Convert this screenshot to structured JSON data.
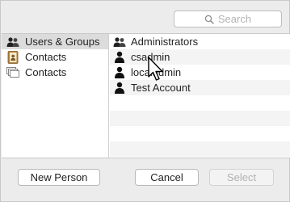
{
  "search": {
    "placeholder": "Search",
    "icon": "magnifier-icon"
  },
  "sources": [
    {
      "label": "Users & Groups",
      "icon": "group-icon",
      "selected": true
    },
    {
      "label": "Contacts",
      "icon": "address-book-icon",
      "selected": false
    },
    {
      "label": "Contacts",
      "icon": "cards-stack-icon",
      "selected": false
    }
  ],
  "members": [
    {
      "label": "Administrators",
      "icon": "group-icon"
    },
    {
      "label": "csadmin",
      "icon": "user-icon"
    },
    {
      "label": "localadmin",
      "icon": "user-icon"
    },
    {
      "label": "Test Account",
      "icon": "user-icon"
    }
  ],
  "buttons": {
    "new_person": "New Person",
    "cancel": "Cancel",
    "select": "Select"
  }
}
